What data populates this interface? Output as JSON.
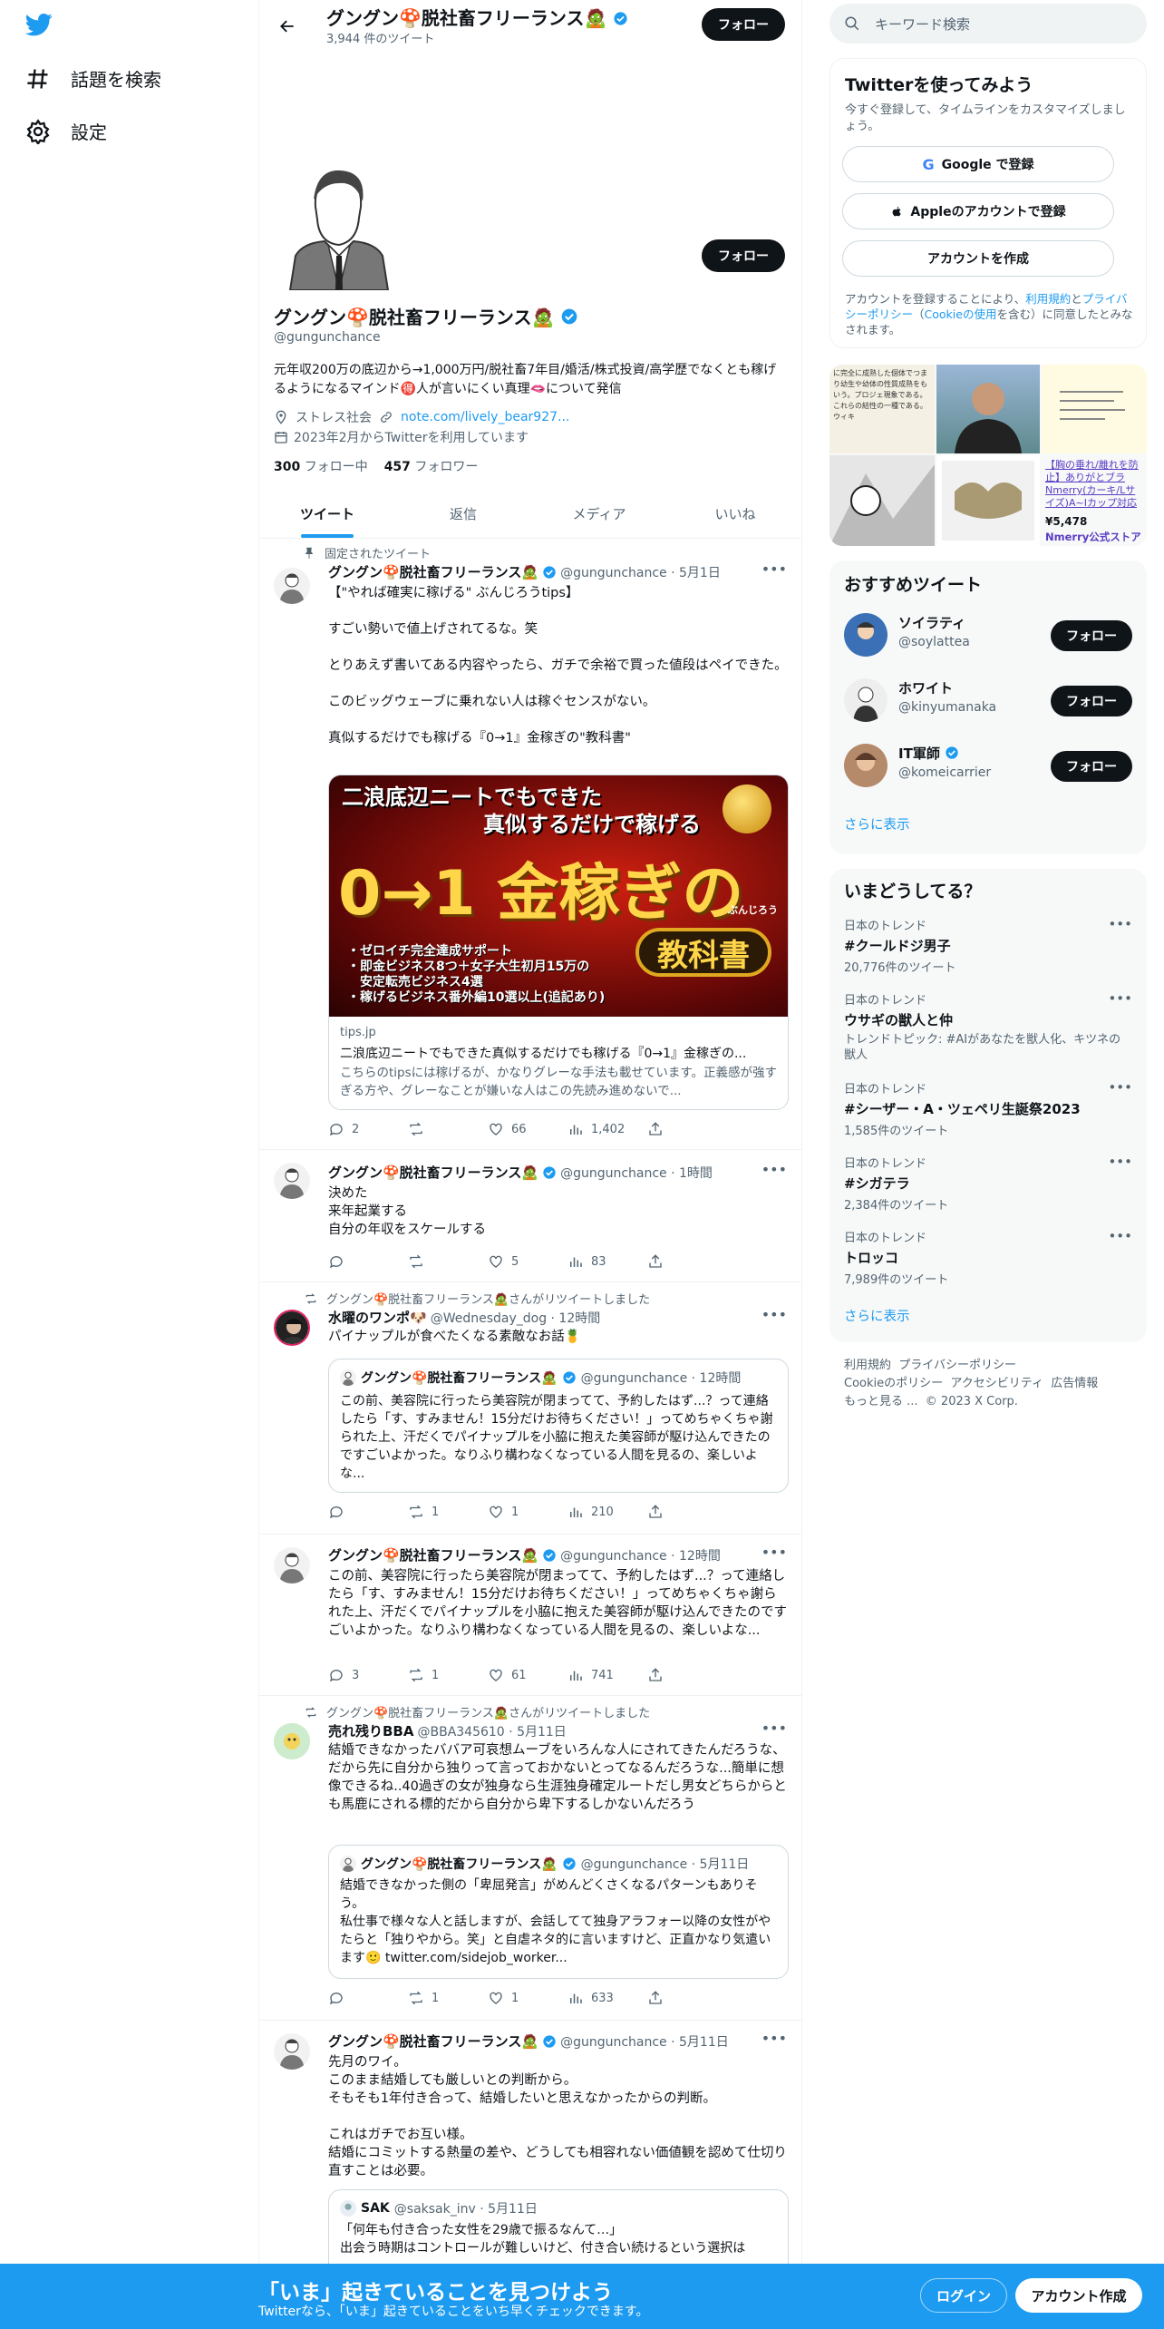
{
  "colors": {
    "accent": "#1d9bf0",
    "text": "#0f1419",
    "secondary": "#536471",
    "like": "#f91880"
  },
  "nav": {
    "explore": "話題を検索",
    "settings": "設定"
  },
  "header": {
    "name": "グングン🍄脱社畜フリーランス🧟",
    "tweet_count": "3,944 件のツイート",
    "follow": "フォロー"
  },
  "profile": {
    "name": "グングン🍄脱社畜フリーランス🧟",
    "handle": "@gungunchance",
    "bio": "元年収200万の底辺から→1,000万円/脱社畜7年目/婚活/株式投資/高学歴でなくとも稼げるようになるマインド🉐人が言いにくい真理🫦について発信",
    "location": "ストレス社会",
    "link": "note.com/lively_bear927...",
    "joined": "2023年2月からTwitterを利用しています",
    "following_count": "300",
    "following_label": "フォロー中",
    "followers_count": "457",
    "followers_label": "フォロワー",
    "follow": "フォロー"
  },
  "tabs": [
    "ツイート",
    "返信",
    "メディア",
    "いいね"
  ],
  "tweets": [
    {
      "pinned": "固定されたツイート",
      "name": "グングン🍄脱社畜フリーランス🧟",
      "meta": "@gungunchance · 5月1日",
      "text": "【\"やれば確実に稼げる\" ぶんじろうtips】\n\nすごい勢いで値上げされてるな。笑\n\nとりあえず書いてある内容やったら、ガチで余裕で買った値段はペイできた。\n\nこのビッグウェーブに乗れない人は稼ぐセンスがない。\n\n真似するだけでも稼げる『0→1』金稼ぎの\"教科書\"",
      "card": {
        "banner_top": "二浪底辺ニートでもできた",
        "banner_mid": "真似するだけで稼げる",
        "banner_big": "0→1 金稼ぎの",
        "banner_book": "教科書",
        "banner_author": "ぶんじろう",
        "bullets": [
          "・ゼロイチ完全達成サポート",
          "・即金ビジネス8つ＋女子大生初月15万の",
          "　安定転売ビジネス4選",
          "・稼げるビジネス番外編10選以上(追記あり)"
        ],
        "domain": "tips.jp",
        "title": "二浪底辺ニートでもできた真似するだけでも稼げる『0→1』金稼ぎの...",
        "desc": "こちらのtipsには稼げるが、かなりグレーな手法も載せています。正義感が強すぎる方や、グレーなことが嫌いな人はこの先読み進めないで..."
      },
      "replies": "2",
      "retweets": "",
      "likes": "66",
      "views": "1,402"
    },
    {
      "name": "グングン🍄脱社畜フリーランス🧟",
      "meta": "@gungunchance · 1時間",
      "text": "決めた\n来年起業する\n自分の年収をスケールする",
      "replies": "",
      "retweets": "",
      "likes": "5",
      "views": "83"
    },
    {
      "social": "グングン🍄脱社畜フリーランス🧟さんがリツイートしました",
      "name": "水曜のワンポ🐶",
      "meta": "@Wednesday_dog · 12時間",
      "text": "パイナップルが食べたくなる素敵なお話🍍",
      "quote": {
        "name": "グングン🍄脱社畜フリーランス🧟",
        "meta": "@gungunchance · 12時間",
        "text": "この前、美容院に行ったら美容院が閉まってて、予約したはず...？って連絡したら「す、すみません！15分だけお待ちください！」ってめちゃくちゃ謝られた上、汗だくでパイナップルを小脇に抱えた美容師が駆け込んできたのですごいよかった。なりふり構わなくなっている人間を見るの、楽しいよな..."
      },
      "replies": "",
      "retweets": "1",
      "likes": "1",
      "views": "210"
    },
    {
      "name": "グングン🍄脱社畜フリーランス🧟",
      "meta": "@gungunchance · 12時間",
      "text": "この前、美容院に行ったら美容院が閉まってて、予約したはず...？って連絡したら「す、すみません！15分だけお待ちください！」ってめちゃくちゃ謝られた上、汗だくでパイナップルを小脇に抱えた美容師が駆け込んできたのですごいよかった。なりふり構わなくなっている人間を見るの、楽しいよな...",
      "replies": "3",
      "retweets": "1",
      "likes": "61",
      "views": "741"
    },
    {
      "social": "グングン🍄脱社畜フリーランス🧟さんがリツイートしました",
      "name": "売れ残りBBA",
      "meta": "@BBA345610 · 5月11日",
      "text": "結婚できなかったババア可哀想ムーブをいろんな人にされてきたんだろうな、だから先に自分から独りって言っておかないとってなるんだろうな...簡単に想像できるね..40過ぎの女が独身なら生涯独身確定ルートだし男女どちらからとも馬鹿にされる標的だから自分から卑下するしかないんだろう",
      "quote": {
        "name": "グングン🍄脱社畜フリーランス🧟",
        "meta": "@gungunchance · 5月11日",
        "text": "結婚できなかった側の「卑屈発言」がめんどくさくなるパターンもありそう。\n私仕事で様々な人と話しますが、会話してて独身アラフォー以降の女性がやたらと「独りやから。笑」と自虐ネタ的に言いますけど、正直かなり気遣います🙂 twitter.com/sidejob_worker..."
      },
      "replies": "",
      "retweets": "1",
      "likes": "1",
      "views": "633"
    },
    {
      "name": "グングン🍄脱社畜フリーランス🧟",
      "meta": "@gungunchance · 5月11日",
      "text": "先月のワイ。\nこのまま結婚しても厳しいとの判断から。\nそもそも1年付き合って、結婚したいと思えなかったからの判断。\n\nこれはガチでお互い様。\n結婚にコミットする熱量の差や、どうしても相容れない価値観を認めて仕切り直すことは必要。",
      "quote": {
        "name": "SAK",
        "meta": "@saksak_inv · 5月11日",
        "text": "「何年も付き合った女性を29歳で振るなんて…」\n出会う時期はコントロールが難しいけど、付き合い続けるという選択は"
      }
    }
  ],
  "right": {
    "search_placeholder": "キーワード検索",
    "signup": {
      "title": "Twitterを使ってみよう",
      "subtitle": "今すぐ登録して、タイムラインをカスタマイズしましょう。",
      "google": "Google で登録",
      "apple": "Appleのアカウントで登録",
      "create": "アカウントを作成",
      "terms_a": "アカウントを登録することにより、",
      "terms_link1": "利用規約",
      "terms_b": "と",
      "terms_link2": "プライバシーポリシー",
      "terms_c": "（",
      "terms_link3": "Cookieの使用",
      "terms_d": "を含む）に同意したとみなされます。"
    },
    "ads": {
      "left_text": "に完全に成熟した個体でつまり幼生や幼体の性質成熟をもいう。プロジェ現象である。これらの結性の一種である。ウィキ",
      "product": "【胸の垂れ/離れを防止】ありがとブラNmerry(カーキ/Lサイズ)A~Iカップ対応",
      "price": "¥5,478",
      "shop": "Nmerry公式ストア"
    },
    "recommend": {
      "title": "おすすめツイート",
      "users": [
        {
          "name": "ソイラティ",
          "handle": "@soylattea"
        },
        {
          "name": "ホワイト",
          "handle": "@kinyumanaka"
        },
        {
          "name": "IT軍師",
          "handle": "@komeicarrier"
        }
      ],
      "follow": "フォロー",
      "more": "さらに表示"
    },
    "trends": {
      "title": "いまどうしてる？",
      "items": [
        {
          "cat": "日本のトレンド",
          "name": "#クールドジ男子",
          "count": "20,776件のツイート"
        },
        {
          "cat": "日本のトレンド",
          "name": "ウサギの獣人と仲",
          "count": "",
          "topic": "トレンドトピック: #AIがあなたを獣人化、キツネの獣人"
        },
        {
          "cat": "日本のトレンド",
          "name": "#シーザー・A・ツェペリ生誕祭2023",
          "count": "1,585件のツイート"
        },
        {
          "cat": "日本のトレンド",
          "name": "#シガテラ",
          "count": "2,384件のツイート"
        },
        {
          "cat": "日本のトレンド",
          "name": "トロッコ",
          "count": "7,989件のツイート"
        }
      ],
      "more": "さらに表示"
    },
    "footer": {
      "l1": "利用規約",
      "l2": "プライバシーポリシー",
      "l3": "Cookieのポリシー",
      "l4": "アクセシビリティ",
      "l5": "広告情報",
      "l6": "もっと見る ...",
      "copy": "© 2023 X Corp."
    }
  },
  "banner": {
    "title": "「いま」起きていることを見つけよう",
    "subtitle": "Twitterなら、「いま」起きていることをいち早くチェックできます。",
    "login": "ログイン",
    "signup": "アカウント作成"
  }
}
